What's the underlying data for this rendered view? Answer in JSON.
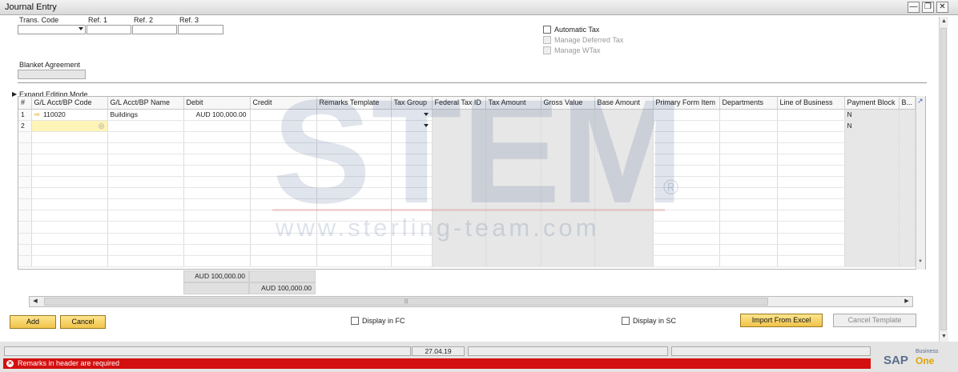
{
  "window": {
    "title": "Journal Entry"
  },
  "header": {
    "trans_code_label": "Trans. Code",
    "ref1_label": "Ref. 1",
    "ref2_label": "Ref. 2",
    "ref3_label": "Ref. 3",
    "blanket_agreement_label": "Blanket Agreement",
    "automatic_tax_label": "Automatic Tax",
    "manage_deferred_tax_label": "Manage Deferred Tax",
    "manage_wtax_label": "Manage WTax",
    "expand_editing_mode_label": "Expand Editing Mode"
  },
  "grid": {
    "columns": [
      "#",
      "G/L Acct/BP Code",
      "G/L Acct/BP Name",
      "Debit",
      "Credit",
      "Remarks Template",
      "Tax Group",
      "Federal Tax ID",
      "Tax Amount",
      "Gross Value",
      "Base Amount",
      "Primary Form Item",
      "Departments",
      "Line of Business",
      "Payment Block",
      "B..."
    ],
    "rows": [
      {
        "no": "1",
        "code": "110020",
        "name": "Buildings",
        "debit": "AUD 100,000.00",
        "credit": "",
        "payment_block": "N"
      },
      {
        "no": "2",
        "code": "",
        "name": "",
        "debit": "",
        "credit": "",
        "payment_block": "N"
      }
    ],
    "total_debit": "AUD 100,000.00",
    "total_credit": "AUD 100,000.00"
  },
  "footer": {
    "add_label": "Add",
    "cancel_label": "Cancel",
    "display_fc_label": "Display in FC",
    "display_sc_label": "Display in SC",
    "import_excel_label": "Import From Excel",
    "cancel_template_label": "Cancel Template"
  },
  "statusbar": {
    "date": "27.04.19",
    "error_message": "Remarks in header are required"
  },
  "branding": {
    "sap": "SAP",
    "business": "Business",
    "one": "One"
  },
  "watermark": {
    "logo": "STEM",
    "url": "www.sterling-team.com"
  },
  "colors": {
    "accent_gold": "#f0c34a",
    "error_red": "#d40f0f"
  }
}
